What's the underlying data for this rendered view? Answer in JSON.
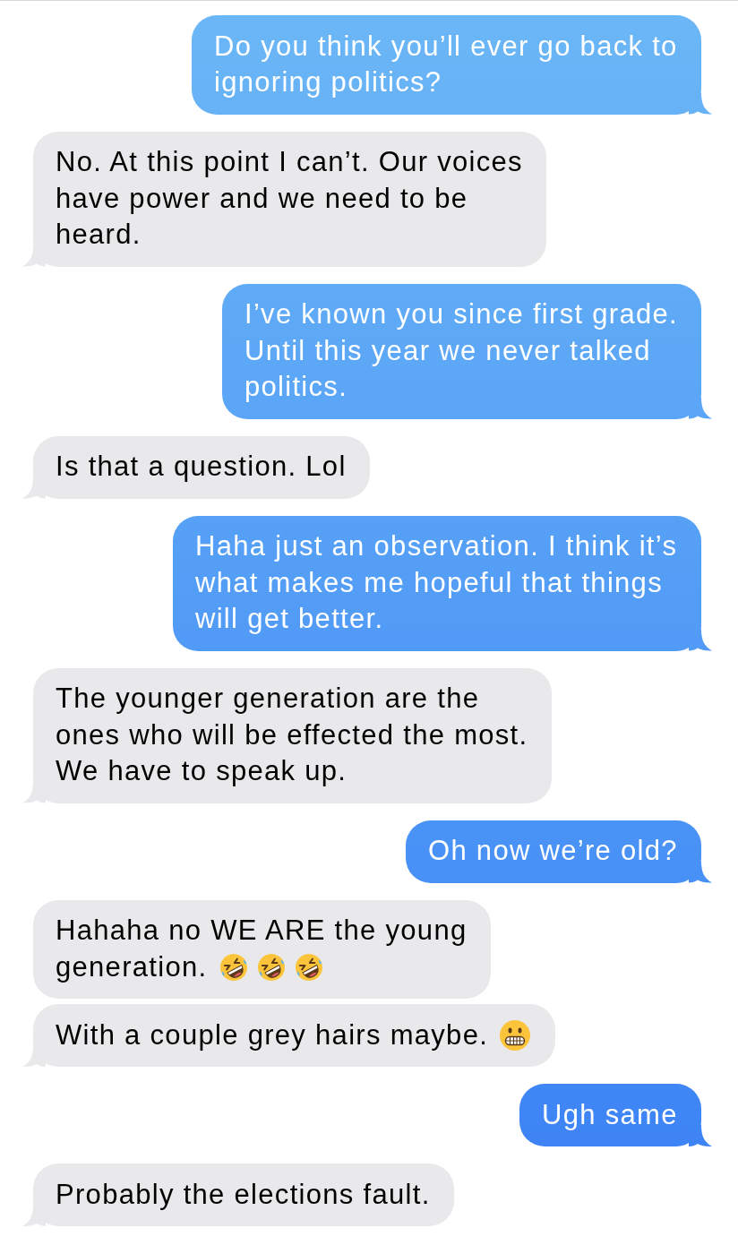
{
  "messages": [
    {
      "kind": "sent",
      "text": "Do you think you’ll ever go back to ignoring politics?",
      "tail": true
    },
    {
      "kind": "received",
      "text": "No. At this point I can’t. Our voices have power and we need to be heard.",
      "tail": true
    },
    {
      "kind": "sent",
      "text": "I’ve known you since first grade. Until this year we never talked politics.",
      "tail": true
    },
    {
      "kind": "received",
      "text": "Is that a question. Lol",
      "tail": true
    },
    {
      "kind": "sent",
      "text": "Haha just an observation. I think it’s what makes me hopeful that things will get better.",
      "tail": true
    },
    {
      "kind": "received",
      "text": "The younger generation are the ones who will be effected the most. We have to speak up.",
      "tail": true
    },
    {
      "kind": "sent",
      "text": "Oh now we’re old?",
      "tail": true
    },
    {
      "kind": "received",
      "text": "Hahaha no WE ARE the young generation.",
      "tail": false,
      "emojis": [
        {
          "kind": "rolling-laughing"
        },
        {
          "kind": "rolling-laughing"
        },
        {
          "kind": "rolling-laughing"
        }
      ]
    },
    {
      "kind": "received",
      "text": "With a couple grey hairs maybe.",
      "tail": true,
      "emojis": [
        {
          "kind": "grimacing"
        }
      ]
    },
    {
      "kind": "sent",
      "text": "Ugh same",
      "tail": true
    },
    {
      "kind": "received",
      "text": "Probably the elections fault.",
      "tail": true
    }
  ]
}
